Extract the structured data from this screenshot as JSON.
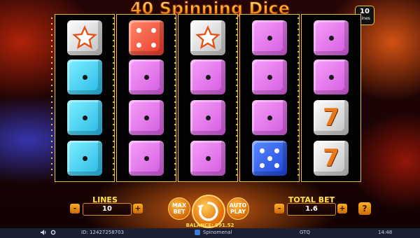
{
  "game": {
    "title": "40 Spinning Dice"
  },
  "lines_badge": {
    "value": "10",
    "label": "Lines"
  },
  "reels": [
    [
      {
        "kind": "star",
        "color": "white"
      },
      {
        "kind": "die",
        "color": "cyan",
        "pips": 1
      },
      {
        "kind": "die",
        "color": "cyan",
        "pips": 1
      },
      {
        "kind": "die",
        "color": "cyan",
        "pips": 1
      }
    ],
    [
      {
        "kind": "die",
        "color": "red",
        "pips": 4
      },
      {
        "kind": "die",
        "color": "magenta",
        "pips": 1
      },
      {
        "kind": "die",
        "color": "magenta",
        "pips": 1
      },
      {
        "kind": "die",
        "color": "magenta",
        "pips": 1
      }
    ],
    [
      {
        "kind": "star",
        "color": "white"
      },
      {
        "kind": "die",
        "color": "magenta",
        "pips": 1
      },
      {
        "kind": "die",
        "color": "magenta",
        "pips": 1
      },
      {
        "kind": "die",
        "color": "magenta",
        "pips": 1
      }
    ],
    [
      {
        "kind": "die",
        "color": "magenta",
        "pips": 1
      },
      {
        "kind": "die",
        "color": "magenta",
        "pips": 1
      },
      {
        "kind": "die",
        "color": "magenta",
        "pips": 1
      },
      {
        "kind": "die",
        "color": "blue",
        "pips": 5
      }
    ],
    [
      {
        "kind": "die",
        "color": "magenta",
        "pips": 1
      },
      {
        "kind": "die",
        "color": "magenta",
        "pips": 1
      },
      {
        "kind": "seven",
        "color": "white"
      },
      {
        "kind": "seven",
        "color": "white"
      }
    ]
  ],
  "controls": {
    "lines_label": "LINES",
    "lines_value": "10",
    "minus": "-",
    "plus": "+",
    "max_bet": "MAX BET",
    "auto_play": "AUTO PLAY",
    "total_bet_label": "TOTAL BET",
    "total_bet_value": "1.6",
    "help": "?",
    "seven_glyph": "7"
  },
  "balance": {
    "text": "BALANCE: 991.52"
  },
  "statusbar": {
    "id": "ID: 12427258703",
    "brand": "Spinomenal",
    "currency": "GTQ",
    "time": "14:48"
  },
  "colors": {
    "frame": "#e8c034",
    "accent": "#ffb021",
    "label": "#ffe14a"
  }
}
